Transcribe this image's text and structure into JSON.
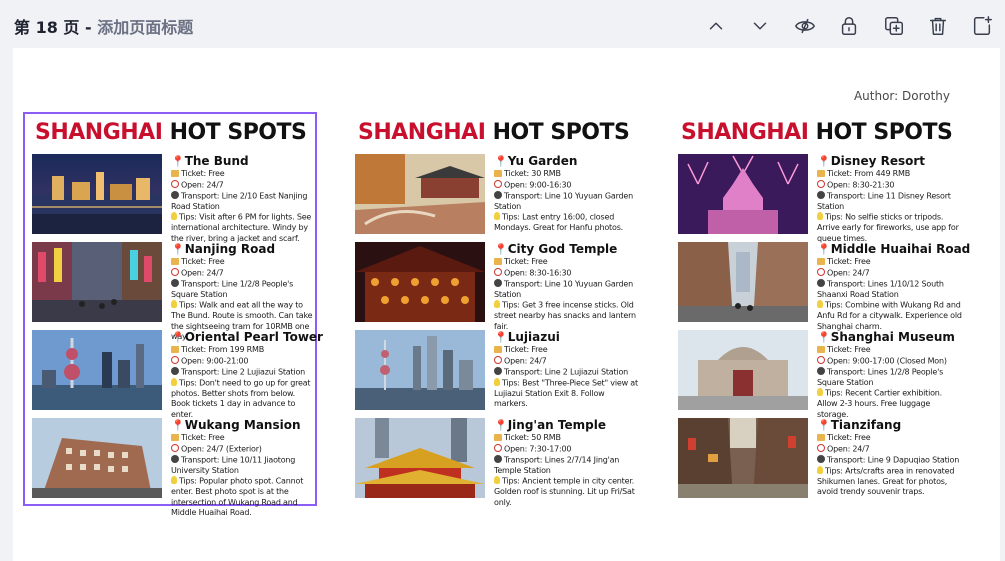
{
  "header": {
    "page_label": "第 18 页",
    "separator": " - ",
    "title_placeholder": "添加页面标题"
  },
  "toolbar": {
    "icons": [
      "chevron-up-icon",
      "chevron-down-icon",
      "hide-eye-icon",
      "lock-icon",
      "duplicate-page-icon",
      "trash-icon",
      "add-page-icon"
    ]
  },
  "canvas": {
    "author": "Author: Dorothy"
  },
  "posters": [
    {
      "title_red": "SHANGHAI",
      "title_black": "HOT SPOTS",
      "selected": true,
      "spots": [
        {
          "name": "The Bund",
          "ticket": "Ticket: Free",
          "open": "Open: 24/7",
          "transport": "Transport: Line 2/10 East Nanjing Road Station",
          "tips": "Tips: Visit after 6 PM for lights. See international architecture. Windy by the river, bring a jacket and scarf."
        },
        {
          "name": "Nanjing Road",
          "ticket": "Ticket: Free",
          "open": "Open: 24/7",
          "transport": "Transport: Line 1/2/8 People's Square Station",
          "tips": "Tips: Walk and eat all the way to The Bund. Route is smooth. Can take the sightseeing tram for 10RMB one way."
        },
        {
          "name": "Oriental Pearl Tower",
          "ticket": "Ticket: From 199 RMB",
          "open": "Open: 9:00-21:00",
          "transport": "Transport: Line 2 Lujiazui Station",
          "tips": "Tips: Don't need to go up for great photos. Better shots from below. Book tickets 1 day in advance to enter."
        },
        {
          "name": "Wukang Mansion",
          "ticket": "Ticket: Free",
          "open": "Open: 24/7 (Exterior)",
          "transport": "Transport: Line 10/11 Jiaotong University Station",
          "tips": "Tips: Popular photo spot. Cannot enter. Best photo spot is at the intersection of Wukang Road and Middle Huaihai Road."
        }
      ]
    },
    {
      "title_red": "SHANGHAI",
      "title_black": "HOT SPOTS",
      "selected": false,
      "spots": [
        {
          "name": "Yu Garden",
          "ticket": "Ticket: 30 RMB",
          "open": "Open: 9:00-16:30",
          "transport": "Transport: Line 10 Yuyuan Garden Station",
          "tips": "Tips: Last entry 16:00, closed Mondays. Great for Hanfu photos."
        },
        {
          "name": "City God Temple",
          "ticket": "Ticket: Free",
          "open": "Open: 8:30-16:30",
          "transport": "Transport: Line 10 Yuyuan Garden Station",
          "tips": "Tips: Get 3 free incense sticks. Old street nearby has snacks and lantern fair."
        },
        {
          "name": "Lujiazui",
          "ticket": "Ticket: Free",
          "open": "Open: 24/7",
          "transport": "Transport: Line 2 Lujiazui Station",
          "tips": "Tips: Best \"Three-Piece Set\" view at Lujiazui Station Exit 8. Follow markers."
        },
        {
          "name": "Jing'an Temple",
          "ticket": "Ticket: 50 RMB",
          "open": "Open: 7:30-17:00",
          "transport": "Transport: Lines 2/7/14 Jing'an Temple Station",
          "tips": "Tips: Ancient temple in city center. Golden roof is stunning. Lit up Fri/Sat only."
        }
      ]
    },
    {
      "title_red": "SHANGHAI",
      "title_black": "HOT SPOTS",
      "selected": false,
      "spots": [
        {
          "name": "Disney Resort",
          "ticket": "Ticket: From 449 RMB",
          "open": "Open: 8:30-21:30",
          "transport": "Transport: Line 11 Disney Resort Station",
          "tips": "Tips: No selfie sticks or tripods. Arrive early for fireworks, use app for queue times."
        },
        {
          "name": "Middle Huaihai Road",
          "ticket": "Ticket: Free",
          "open": "Open: 24/7",
          "transport": "Transport: Lines 1/10/12 South Shaanxi Road Station",
          "tips": "Tips: Combine with Wukang Rd and Anfu Rd for a citywalk. Experience old Shanghai charm."
        },
        {
          "name": "Shanghai Museum",
          "ticket": "Ticket: Free",
          "open": "Open: 9:00-17:00 (Closed Mon)",
          "transport": "Transport: Lines 1/2/8 People's Square Station",
          "tips": "Tips: Recent Cartier exhibition. Allow 2-3 hours. Free luggage storage."
        },
        {
          "name": "Tianzifang",
          "ticket": "Ticket: Free",
          "open": "Open: 24/7",
          "transport": "Transport: Line 9 Dapuqiao Station",
          "tips": "Tips: Arts/crafts area in renovated Shikumen lanes. Great for photos, avoid trendy souvenir traps."
        }
      ]
    }
  ],
  "colors": {
    "title_red": "#c8102e",
    "selection": "#8b5cf6",
    "background": "#f1f2f6"
  }
}
